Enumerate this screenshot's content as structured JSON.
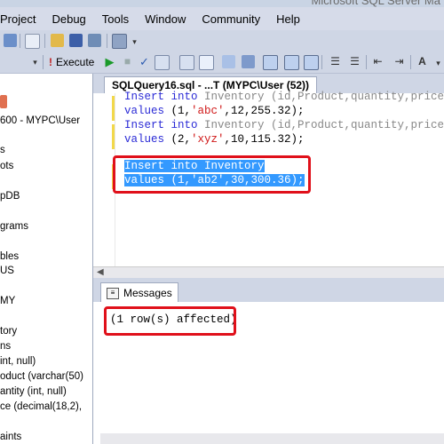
{
  "window": {
    "title": "Microsoft SQL Server Ma"
  },
  "menu": [
    "Project",
    "Debug",
    "Tools",
    "Window",
    "Community",
    "Help"
  ],
  "toolbar": {
    "execute_label": "Execute"
  },
  "explorer": {
    "server": "600 - MYPC\\User",
    "items": [
      "s",
      "ots",
      "pDB",
      "grams",
      "bles",
      "US",
      "MY",
      "tory",
      "ns",
      "int, null)",
      "oduct (varchar(50)",
      "antity (int, null)",
      "ce (decimal(18,2),",
      "aints"
    ]
  },
  "document_tab": {
    "label": "SQLQuery16.sql - ...T (MYPC\\User (52))"
  },
  "editor": {
    "lines": [
      {
        "kw": "Insert into",
        "rest": " Inventory (id,Product,quantity,price"
      },
      {
        "kw": "values",
        "rest": " (1,",
        "str": "'abc'",
        "tail": ",12,255.32);"
      },
      {
        "kw": "Insert into",
        "rest": " Inventory (id,Product,quantity,price"
      },
      {
        "kw": "values",
        "rest": " (2,",
        "str": "'xyz'",
        "tail": ",10,115.32);"
      },
      {
        "sel": "Insert into Inventory"
      },
      {
        "sel": "values (1,'ab2',30,300.36);"
      }
    ]
  },
  "messages": {
    "tab_label": "Messages",
    "text": "(1 row(s) affected)"
  },
  "colors": {
    "highlight_box": "#e0101a",
    "selection": "#3399ff",
    "keyword": "#2b2bd6",
    "string": "#d01818"
  }
}
